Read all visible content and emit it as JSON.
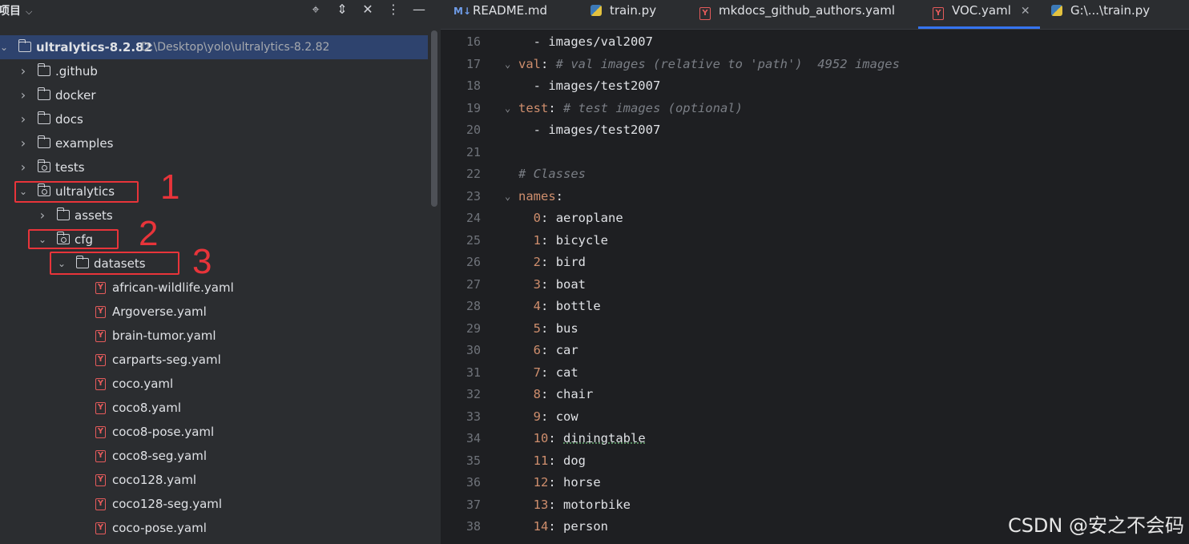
{
  "project_panel": {
    "title": "项目",
    "root": {
      "name": "ultralytics-8.2.82",
      "path": "D:\\Desktop\\yolo\\ultralytics-8.2.82"
    },
    "items": [
      {
        "label": ".github",
        "type": "folder"
      },
      {
        "label": "docker",
        "type": "folder"
      },
      {
        "label": "docs",
        "type": "folder"
      },
      {
        "label": "examples",
        "type": "folder"
      },
      {
        "label": "tests",
        "type": "package"
      },
      {
        "label": "ultralytics",
        "type": "package"
      },
      {
        "label": "assets",
        "type": "folder"
      },
      {
        "label": "cfg",
        "type": "package"
      },
      {
        "label": "datasets",
        "type": "folder"
      }
    ],
    "files": [
      "african-wildlife.yaml",
      "Argoverse.yaml",
      "brain-tumor.yaml",
      "carparts-seg.yaml",
      "coco.yaml",
      "coco8.yaml",
      "coco8-pose.yaml",
      "coco8-seg.yaml",
      "coco128.yaml",
      "coco128-seg.yaml",
      "coco-pose.yaml"
    ],
    "annotations": [
      "1",
      "2",
      "3"
    ]
  },
  "tabs": [
    {
      "label": "README.md",
      "icon": "markdown-icon",
      "icon_text": "M↓"
    },
    {
      "label": "train.py",
      "icon": "python-icon"
    },
    {
      "label": "mkdocs_github_authors.yaml",
      "icon": "yaml-icon"
    },
    {
      "label": "VOC.yaml",
      "icon": "yaml-icon",
      "active": true
    },
    {
      "label": "G:\\...\\train.py",
      "icon": "python-icon"
    }
  ],
  "editor": {
    "lines": [
      {
        "n": "16",
        "key": "",
        "text": "  - images/val2007",
        "comment": ""
      },
      {
        "n": "17",
        "key": "val",
        "text": "",
        "comment": "# val images (relative to 'path')  4952 images",
        "fold": true
      },
      {
        "n": "18",
        "key": "",
        "text": "  - images/test2007",
        "comment": ""
      },
      {
        "n": "19",
        "key": "test",
        "text": "",
        "comment": "# test images (optional)",
        "fold": true
      },
      {
        "n": "20",
        "key": "",
        "text": "  - images/test2007",
        "comment": ""
      },
      {
        "n": "21",
        "key": "",
        "text": "",
        "comment": ""
      },
      {
        "n": "22",
        "key": "",
        "text": "",
        "comment": "# Classes"
      },
      {
        "n": "23",
        "key": "names",
        "text": "",
        "comment": "",
        "fold": true
      },
      {
        "n": "24",
        "idx": "0",
        "val": "aeroplane"
      },
      {
        "n": "25",
        "idx": "1",
        "val": "bicycle"
      },
      {
        "n": "26",
        "idx": "2",
        "val": "bird"
      },
      {
        "n": "27",
        "idx": "3",
        "val": "boat"
      },
      {
        "n": "28",
        "idx": "4",
        "val": "bottle"
      },
      {
        "n": "29",
        "idx": "5",
        "val": "bus"
      },
      {
        "n": "30",
        "idx": "6",
        "val": "car"
      },
      {
        "n": "31",
        "idx": "7",
        "val": "cat"
      },
      {
        "n": "32",
        "idx": "8",
        "val": "chair"
      },
      {
        "n": "33",
        "idx": "9",
        "val": "cow"
      },
      {
        "n": "34",
        "idx": "10",
        "val": "diningtable"
      },
      {
        "n": "35",
        "idx": "11",
        "val": "dog"
      },
      {
        "n": "36",
        "idx": "12",
        "val": "horse"
      },
      {
        "n": "37",
        "idx": "13",
        "val": "motorbike"
      },
      {
        "n": "38",
        "idx": "14",
        "val": "person"
      }
    ]
  },
  "watermark": "CSDN @安之不会码"
}
